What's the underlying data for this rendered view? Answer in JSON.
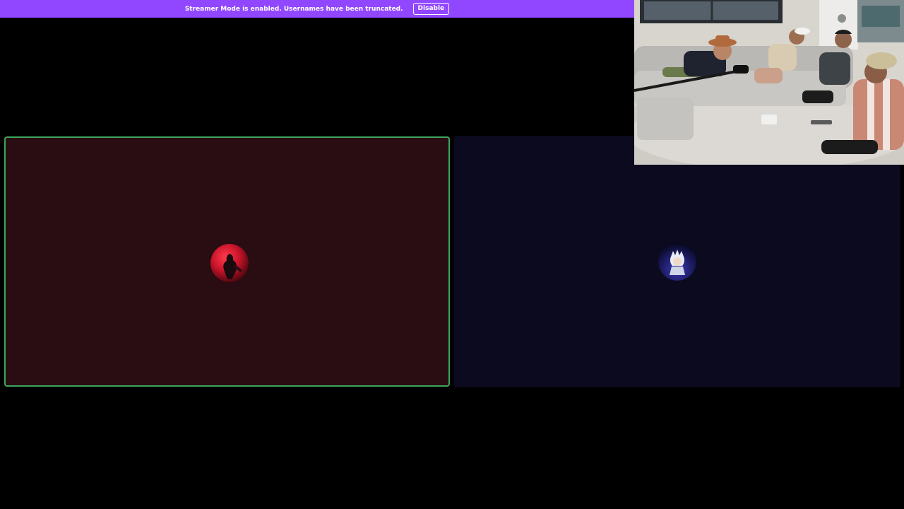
{
  "banner": {
    "message": "Streamer Mode is enabled. Usernames have been truncated.",
    "disable_label": "Disable",
    "color": "#9147ff"
  },
  "call": {
    "participants": [
      {
        "avatar_icon": "avatar-red-moon-figure",
        "tile_color": "#2a0c13",
        "speaking": true,
        "speaking_ring_color": "#3ba55c"
      },
      {
        "avatar_icon": "avatar-white-haired-character",
        "tile_color": "#0c0a1f",
        "speaking": false
      }
    ]
  },
  "webcam": {
    "scene": "webcam-feed-living-room"
  }
}
